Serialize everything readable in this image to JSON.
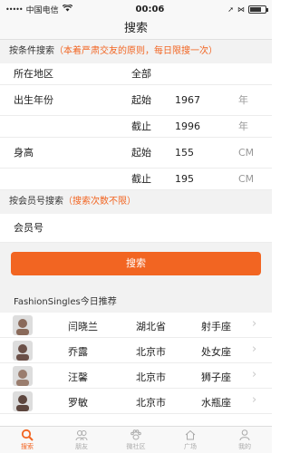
{
  "status": {
    "dots": "•••••",
    "carrier": "中国电信",
    "wifi": "wifi-icon",
    "time": "00:06",
    "battery_level": 0.7
  },
  "nav": {
    "title": "搜索"
  },
  "condition_section": {
    "label": "按条件搜索",
    "note": "（本着严肃交友的原则，每日限搜一次）"
  },
  "location": {
    "label": "所在地区",
    "value": "全部"
  },
  "birth_year": {
    "label": "出生年份",
    "start_label": "起始",
    "start_value": "1967",
    "start_unit": "年",
    "end_label": "截止",
    "end_value": "1996",
    "end_unit": "年"
  },
  "height": {
    "label": "身高",
    "start_label": "起始",
    "start_value": "155",
    "start_unit": "CM",
    "end_label": "截止",
    "end_value": "195",
    "end_unit": "CM"
  },
  "member_section": {
    "label": "按会员号搜索",
    "note": "（搜索次数不限）"
  },
  "member": {
    "label": "会员号"
  },
  "search_button": {
    "label": "搜索"
  },
  "recommend": {
    "header": "FashionSingles今日推荐",
    "rows": [
      {
        "name": "闫晓兰",
        "city": "湖北省",
        "sign": "射手座",
        "avatar_color": "#8a6a5a"
      },
      {
        "name": "乔露",
        "city": "北京市",
        "sign": "处女座",
        "avatar_color": "#6b5048"
      },
      {
        "name": "汪馨",
        "city": "北京市",
        "sign": "狮子座",
        "avatar_color": "#9a7d6e"
      },
      {
        "name": "罗敏",
        "city": "北京市",
        "sign": "水瓶座",
        "avatar_color": "#5d463e"
      }
    ]
  },
  "tabs": [
    {
      "label": "搜索",
      "icon": "search-icon",
      "active": true
    },
    {
      "label": "朋友",
      "icon": "friends-icon",
      "active": false
    },
    {
      "label": "微社区",
      "icon": "paw-icon",
      "active": false
    },
    {
      "label": "广场",
      "icon": "home-icon",
      "active": false
    },
    {
      "label": "我的",
      "icon": "person-icon",
      "active": false
    }
  ],
  "colors": {
    "accent": "#f26522",
    "background": "#f2f2f2"
  }
}
